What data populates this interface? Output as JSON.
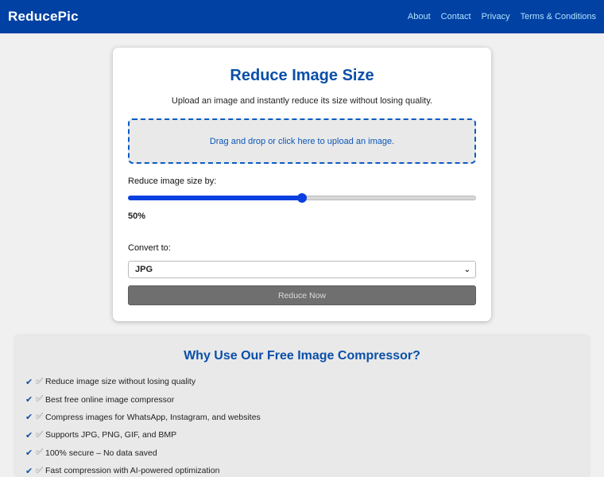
{
  "header": {
    "brand": "ReducePic",
    "nav": [
      "About",
      "Contact",
      "Privacy",
      "Terms & Conditions"
    ]
  },
  "tool": {
    "title": "Reduce Image Size",
    "subtitle": "Upload an image and instantly reduce its size without losing quality.",
    "dropzone_text": "Drag and drop or click here to upload an image.",
    "slider_label": "Reduce image size by:",
    "slider_value": 50,
    "slider_value_text": "50%",
    "convert_label": "Convert to:",
    "convert_selected": "JPG",
    "button_label": "Reduce Now"
  },
  "why": {
    "title": "Why Use Our Free Image Compressor?",
    "check_glyph": "✔",
    "secondary_glyph": "✅",
    "items": [
      "Reduce image size without losing quality",
      "Best free online image compressor",
      "Compress images for WhatsApp, Instagram, and websites",
      "Supports JPG, PNG, GIF, and BMP",
      "100% secure – No data saved",
      "Fast compression with AI-powered optimization"
    ]
  },
  "colors": {
    "header_bg": "#0041a3",
    "accent": "#0a4fa8",
    "slider": "#0a3fe0"
  }
}
